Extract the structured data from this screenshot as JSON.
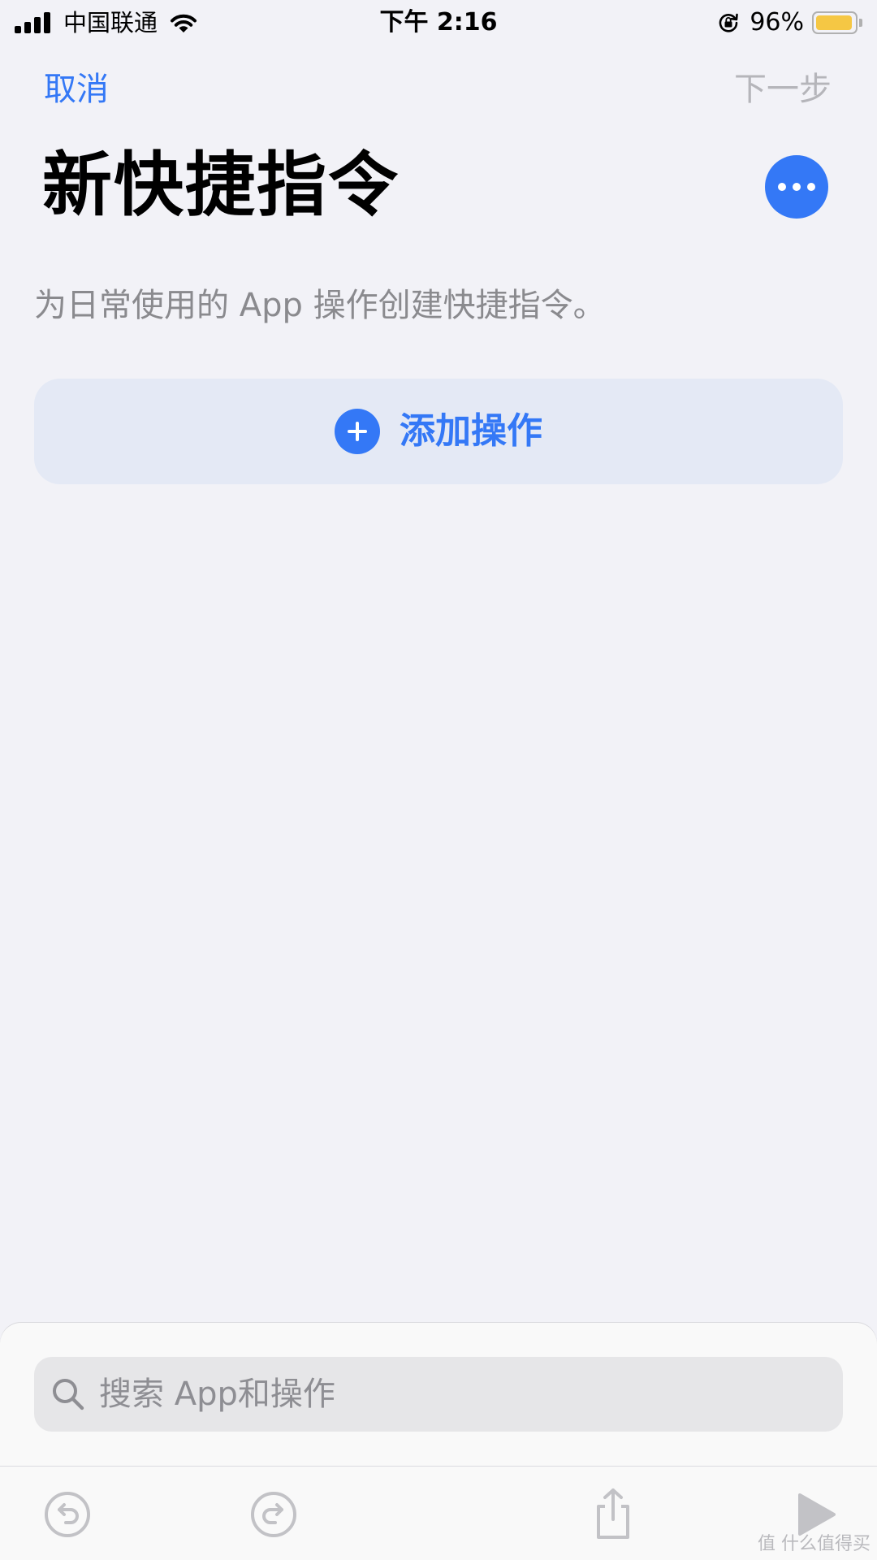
{
  "status_bar": {
    "carrier": "中国联通",
    "time": "下午 2:16",
    "battery_percent": "96%",
    "battery_level": 0.96,
    "battery_color": "#f5c744",
    "icons": [
      "cellular-signal-icon",
      "wifi-icon",
      "orientation-lock-icon",
      "battery-icon"
    ]
  },
  "nav": {
    "cancel_label": "取消",
    "next_label": "下一步"
  },
  "page": {
    "title": "新快捷指令",
    "description": "为日常使用的 App 操作创建快捷指令。",
    "more_icon": "ellipsis-icon"
  },
  "add_action": {
    "label": "添加操作",
    "icon": "plus-circle-icon"
  },
  "search": {
    "placeholder": "搜索 App和操作",
    "value": "",
    "icon": "search-icon"
  },
  "toolbar": {
    "icons": [
      "undo-icon",
      "redo-icon",
      "share-icon",
      "play-icon"
    ]
  },
  "watermark": "值 什么值得买",
  "colors": {
    "accent": "#3478f6",
    "background": "#f2f2f7",
    "disabled_text": "#b5b5ba",
    "secondary_text": "#8a8a8e",
    "add_action_bg": "#e4e9f5"
  }
}
